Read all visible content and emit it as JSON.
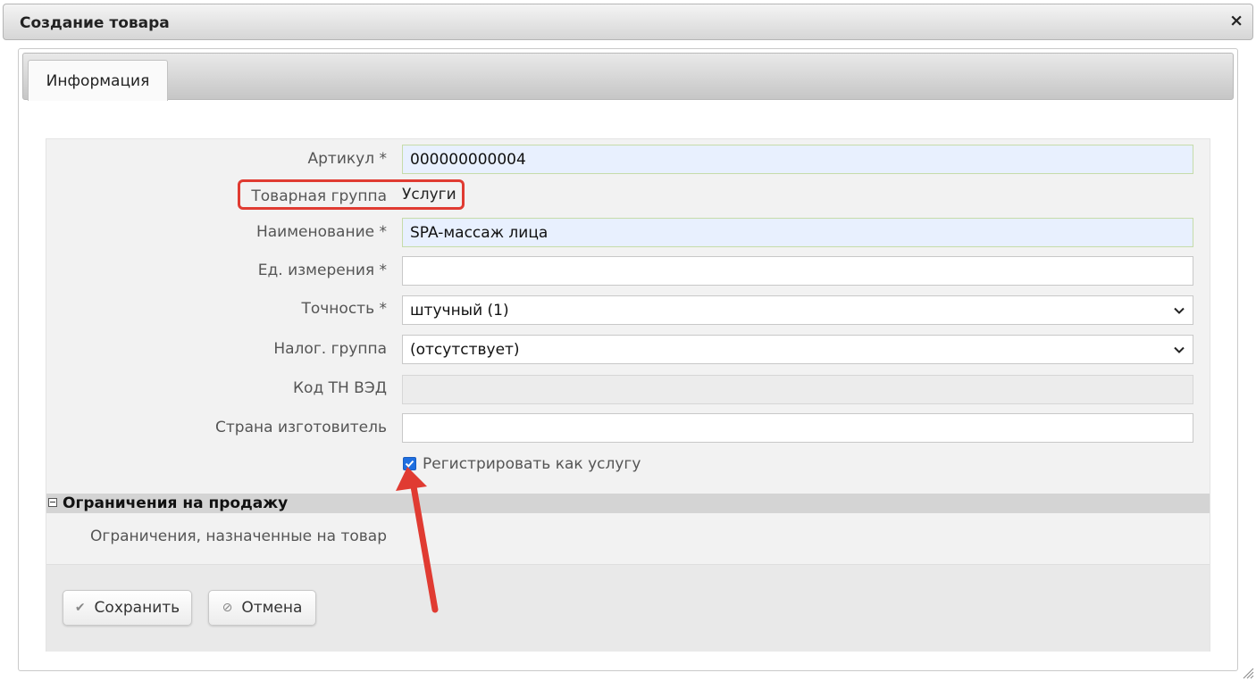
{
  "dialog": {
    "title": "Создание товара",
    "close_glyph": "×"
  },
  "tabs": [
    {
      "label": "Информация",
      "active": true
    }
  ],
  "form": {
    "article": {
      "label": "Артикул *",
      "value": "000000000004"
    },
    "product_group": {
      "label": "Товарная группа",
      "value": "Услуги"
    },
    "name": {
      "label": "Наименование *",
      "value": "SPA-массаж лица"
    },
    "unit": {
      "label": "Ед. измерения *",
      "value": ""
    },
    "precision": {
      "label": "Точность *",
      "value": "штучный (1)"
    },
    "tax_group": {
      "label": "Налог. группа",
      "value": "(отсутствует)"
    },
    "tn_ved": {
      "label": "Код ТН ВЭД",
      "value": ""
    },
    "country": {
      "label": "Страна изготовитель",
      "value": ""
    },
    "register_as_service": {
      "label": "Регистрировать как услугу",
      "checked": true
    }
  },
  "sales_restrictions": {
    "header": "Ограничения на продажу",
    "label": "Ограничения, назначенные на товар"
  },
  "buttons": {
    "save": {
      "label": "Сохранить",
      "icon": "check-icon"
    },
    "cancel": {
      "label": "Отмена",
      "icon": "cancel-icon"
    }
  },
  "colors": {
    "annotation": "#e03b32",
    "checkbox": "#1f6fe0",
    "filled_field": "#e8f0fe"
  }
}
